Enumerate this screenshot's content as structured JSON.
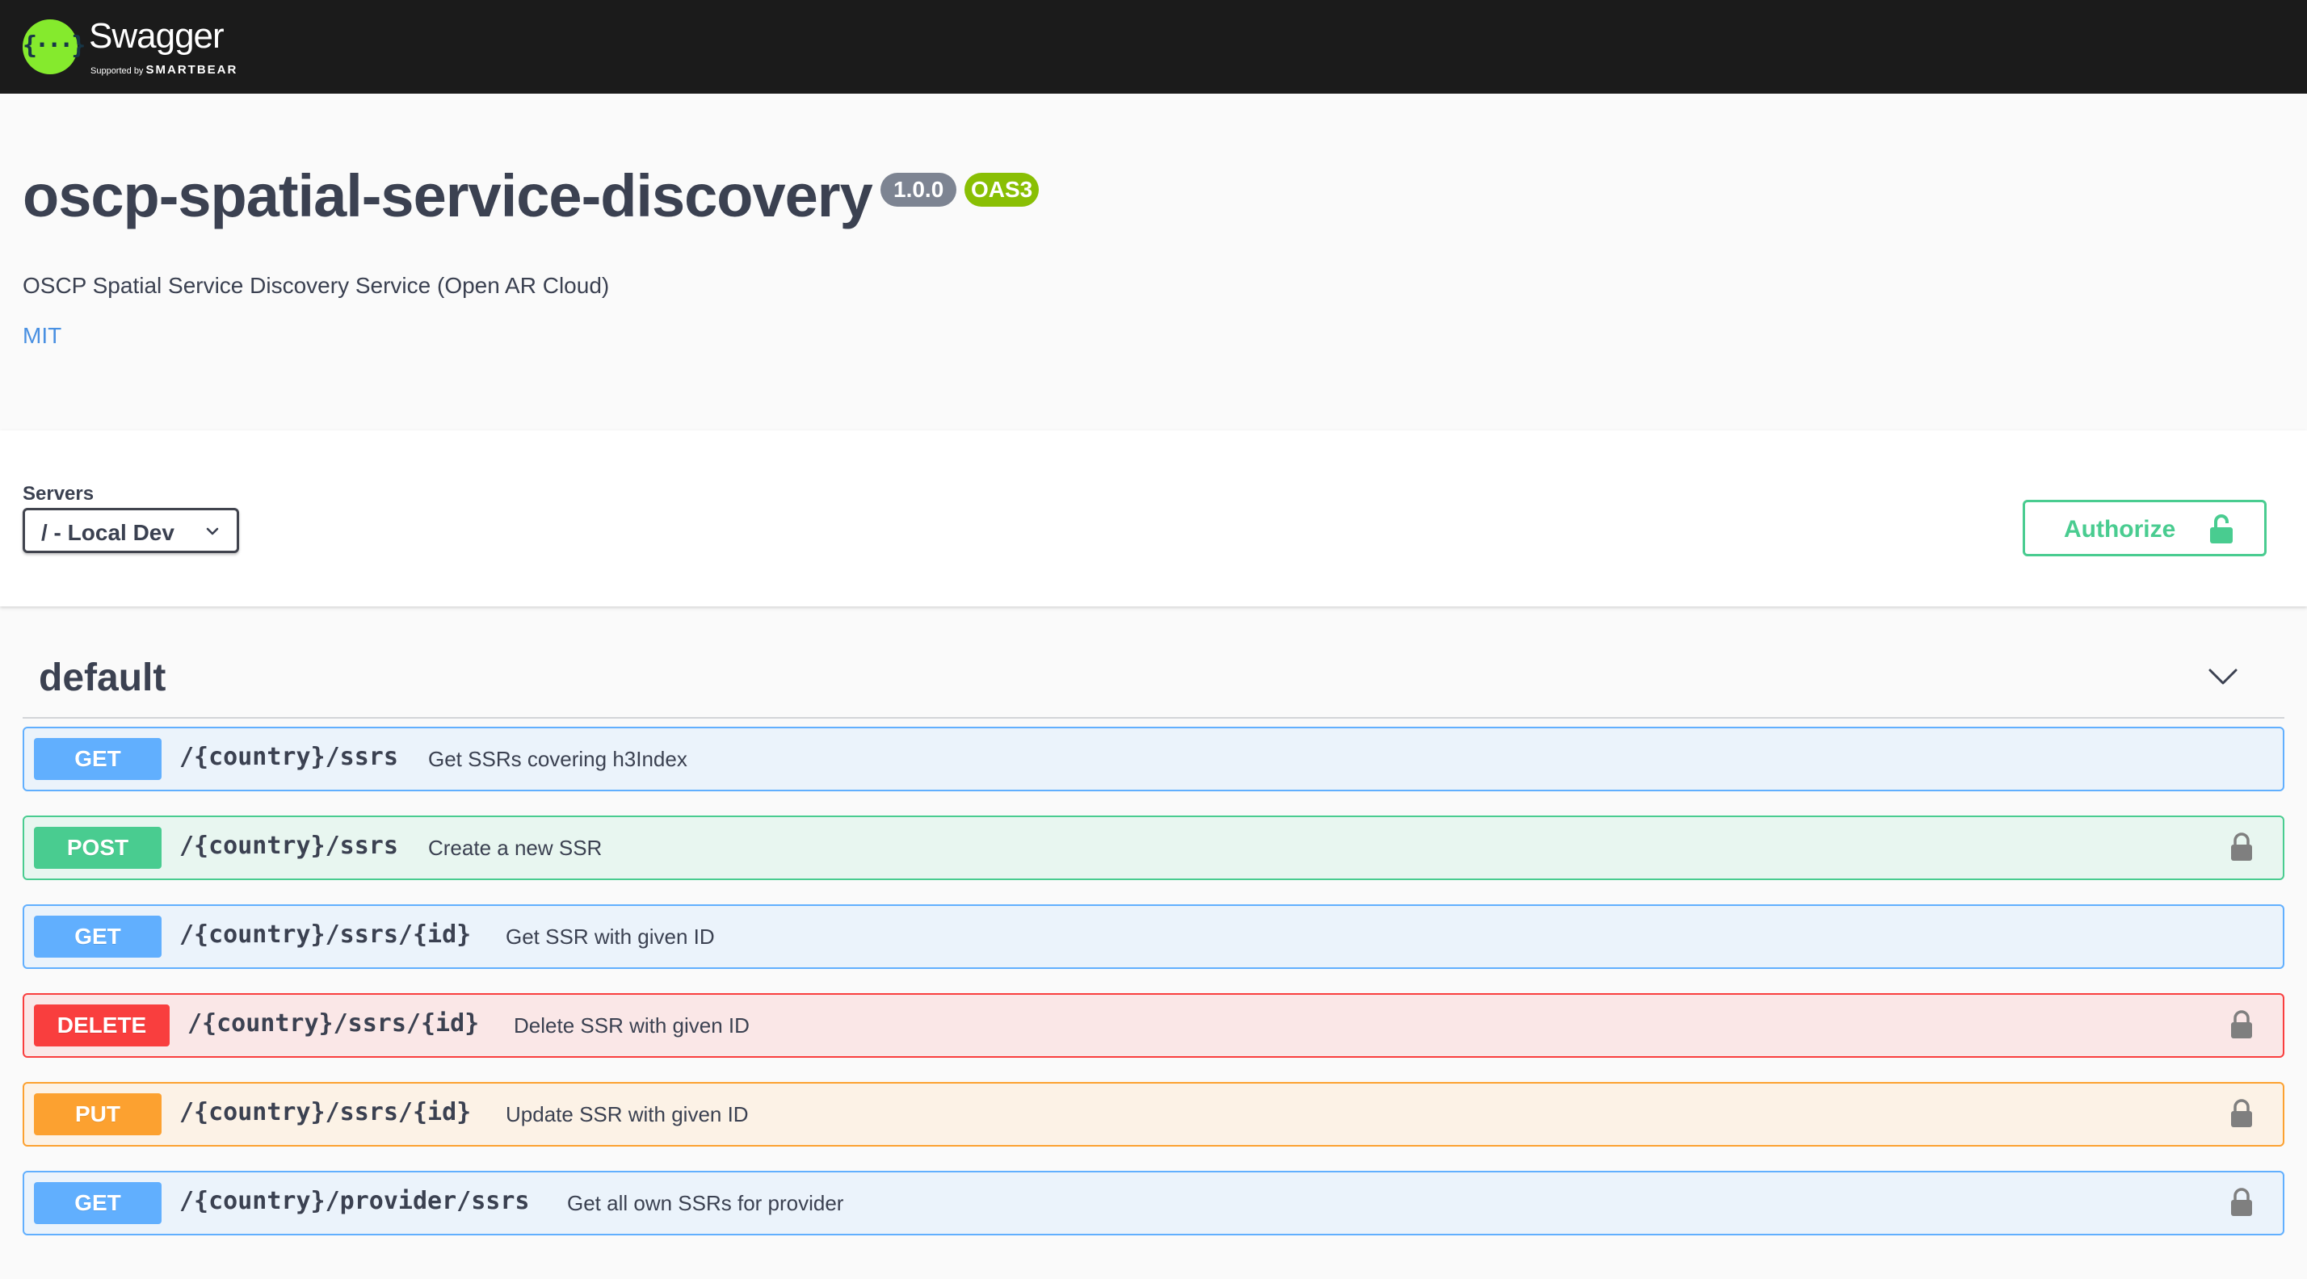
{
  "topbar": {
    "logo_glyph": "{···}",
    "logo_name": "Swagger",
    "supported_by": "Supported by",
    "smartbear": "SMARTBEAR"
  },
  "info": {
    "title": "oscp-spatial-service-discovery",
    "version": "1.0.0",
    "oas_badge": "OAS3",
    "description": "OSCP Spatial Service Discovery Service (Open AR Cloud)",
    "license": "MIT"
  },
  "servers": {
    "label": "Servers",
    "selected": "/ - Local Dev"
  },
  "authorize": {
    "label": "Authorize",
    "icon": "unlocked-padlock-icon"
  },
  "tag": {
    "name": "default",
    "expanded": true
  },
  "operations": [
    {
      "method": "GET",
      "path": "/{country}/ssrs",
      "summary": "Get SSRs covering h3Index",
      "locked": false
    },
    {
      "method": "POST",
      "path": "/{country}/ssrs",
      "summary": "Create a new SSR",
      "locked": true
    },
    {
      "method": "GET",
      "path": "/{country}/ssrs/{id}",
      "summary": "Get SSR with given ID",
      "locked": false
    },
    {
      "method": "DELETE",
      "path": "/{country}/ssrs/{id}",
      "summary": "Delete SSR with given ID",
      "locked": true
    },
    {
      "method": "PUT",
      "path": "/{country}/ssrs/{id}",
      "summary": "Update SSR with given ID",
      "locked": true
    },
    {
      "method": "GET",
      "path": "/{country}/provider/ssrs",
      "summary": "Get all own SSRs for provider",
      "locked": true
    }
  ],
  "colors": {
    "topbar": "#1b1b1b",
    "logo_green": "#85ea2d",
    "get": "#61affe",
    "post": "#49cc90",
    "delete": "#f93e3e",
    "put": "#fca130",
    "version_badge": "#7d8492",
    "oas_badge": "#89bf04",
    "link": "#4990e2"
  }
}
